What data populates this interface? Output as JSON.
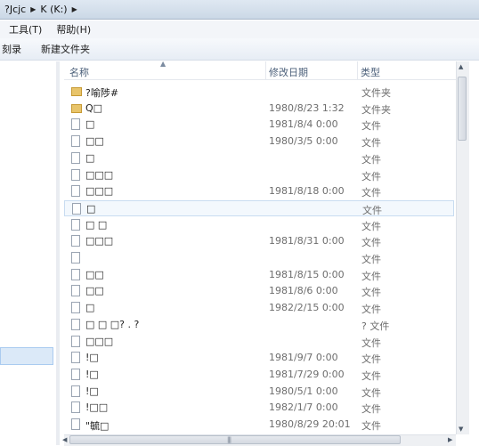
{
  "titlebar": {
    "crumb1": "?Jcjc",
    "crumb2": "K (K:)"
  },
  "menu": {
    "items": [
      "工具(T)",
      "帮助(H)"
    ]
  },
  "toolbar": {
    "items": [
      "刻录",
      "新建文件夹"
    ]
  },
  "columns": {
    "name": "名称",
    "date": "修改日期",
    "type": "类型"
  },
  "files": [
    {
      "icon": "folder",
      "name": "?喻陟#",
      "date": "",
      "type": "文件夹"
    },
    {
      "icon": "folder",
      "name": "Q□",
      "date": "1980/8/23 1:32",
      "type": "文件夹"
    },
    {
      "icon": "doc",
      "name": "□",
      "date": "1981/8/4 0:00",
      "type": "文件"
    },
    {
      "icon": "doc",
      "name": "□□",
      "date": "1980/3/5 0:00",
      "type": "文件"
    },
    {
      "icon": "doc",
      "name": "□",
      "date": "",
      "type": "文件"
    },
    {
      "icon": "doc",
      "name": "□□□",
      "date": "",
      "type": "文件"
    },
    {
      "icon": "doc",
      "name": "□□□",
      "date": "1981/8/18 0:00",
      "type": "文件"
    },
    {
      "icon": "doc",
      "name": "□",
      "date": "",
      "type": "文件",
      "selected": true
    },
    {
      "icon": "doc",
      "name": "□ □",
      "date": "",
      "type": "文件"
    },
    {
      "icon": "doc",
      "name": "□□□",
      "date": "1981/8/31 0:00",
      "type": "文件"
    },
    {
      "icon": "doc",
      "name": "",
      "date": "",
      "type": "文件"
    },
    {
      "icon": "doc",
      "name": " □□",
      "date": "1981/8/15 0:00",
      "type": "文件"
    },
    {
      "icon": "doc",
      "name": " □□",
      "date": "1981/8/6 0:00",
      "type": "文件"
    },
    {
      "icon": "doc",
      "name": " □",
      "date": "1982/2/15 0:00",
      "type": "文件"
    },
    {
      "icon": "doc",
      "name": "□ □ □? . ?",
      "date": "",
      "type": " ? 文件"
    },
    {
      "icon": "doc",
      "name": "□□□",
      "date": "",
      "type": "文件"
    },
    {
      "icon": "doc",
      "name": "!□",
      "date": "1981/9/7 0:00",
      "type": "文件"
    },
    {
      "icon": "doc",
      "name": "!□",
      "date": "1981/7/29 0:00",
      "type": "文件"
    },
    {
      "icon": "doc",
      "name": "!□",
      "date": "1980/5/1 0:00",
      "type": "文件"
    },
    {
      "icon": "doc",
      "name": "!□□",
      "date": "1982/1/7 0:00",
      "type": "文件"
    },
    {
      "icon": "doc",
      "name": "\"毓□",
      "date": "1980/8/29 20:01",
      "type": "文件"
    }
  ],
  "icons": {
    "folder": "folder-icon",
    "doc": "file-icon",
    "breadcrumb_arrow": "chevron-right-icon",
    "sort": "sort-up-icon"
  }
}
